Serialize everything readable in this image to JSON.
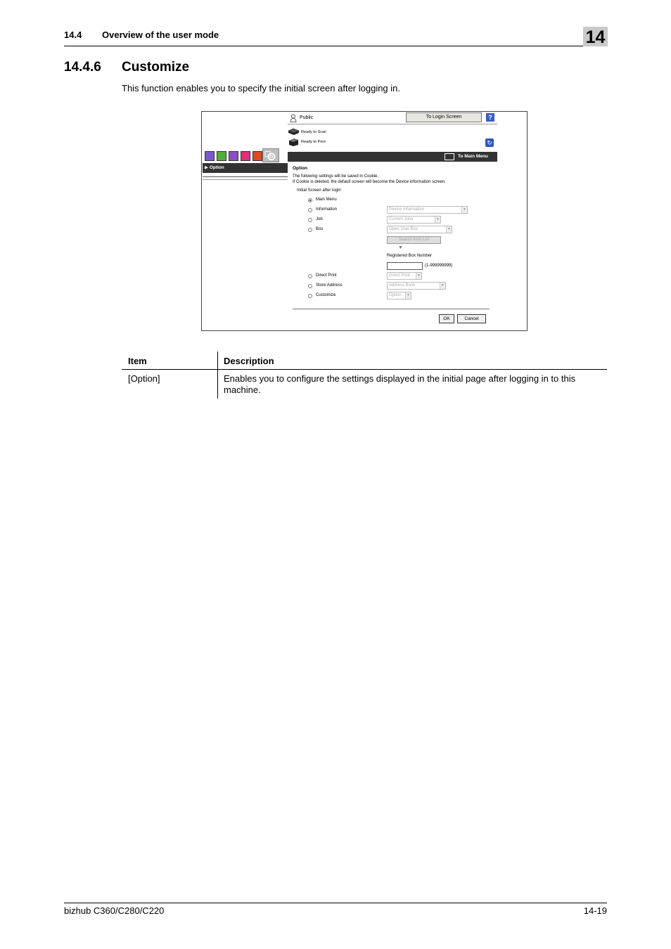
{
  "header": {
    "section_number": "14.4",
    "section_title": "Overview of the user mode",
    "chapter": "14"
  },
  "section": {
    "number": "14.4.6",
    "title": "Customize",
    "intro": "This function enables you to specify the initial screen after logging in."
  },
  "screenshot": {
    "user": "Public",
    "login_button": "To Login Screen",
    "help": "?",
    "status_scan": "Ready to Scan",
    "status_print": "Ready to Print",
    "main_menu_link": "To Main Menu",
    "sidebar_item": "Option",
    "page_title": "Option",
    "note_line1": "The following settings will be saved in Cookie.",
    "note_line2": "If Cookie is deleted, the default screen will become the Device information screen.",
    "initial_screen_label": "Initial Screen after login",
    "options": [
      {
        "label": "Main Menu",
        "selected": true
      },
      {
        "label": "Information",
        "selected": false,
        "select": "Device Information"
      },
      {
        "label": "Job",
        "selected": false,
        "select": "Current Jobs"
      },
      {
        "label": "Box",
        "selected": false,
        "select": "Open User Box"
      },
      {
        "label": "Direct Print",
        "selected": false,
        "select": "Direct Print"
      },
      {
        "label": "Store Address",
        "selected": false,
        "select": "Address Book"
      },
      {
        "label": "Customize",
        "selected": false,
        "select": "Option"
      }
    ],
    "search_button": "Search from List",
    "registered_box_label": "Registered Box Number",
    "registered_box_range": "(1-999999999)",
    "ok_button": "OK",
    "cancel_button": "Cancel"
  },
  "table": {
    "headers": [
      "Item",
      "Description"
    ],
    "rows": [
      {
        "item": "[Option]",
        "description": "Enables you to configure the settings displayed in the initial page after logging in to this machine."
      }
    ]
  },
  "footer": {
    "product": "bizhub C360/C280/C220",
    "page": "14-19"
  },
  "colors": {
    "chapter_box": "#c9c9c9",
    "menu_bar": "#333333"
  }
}
